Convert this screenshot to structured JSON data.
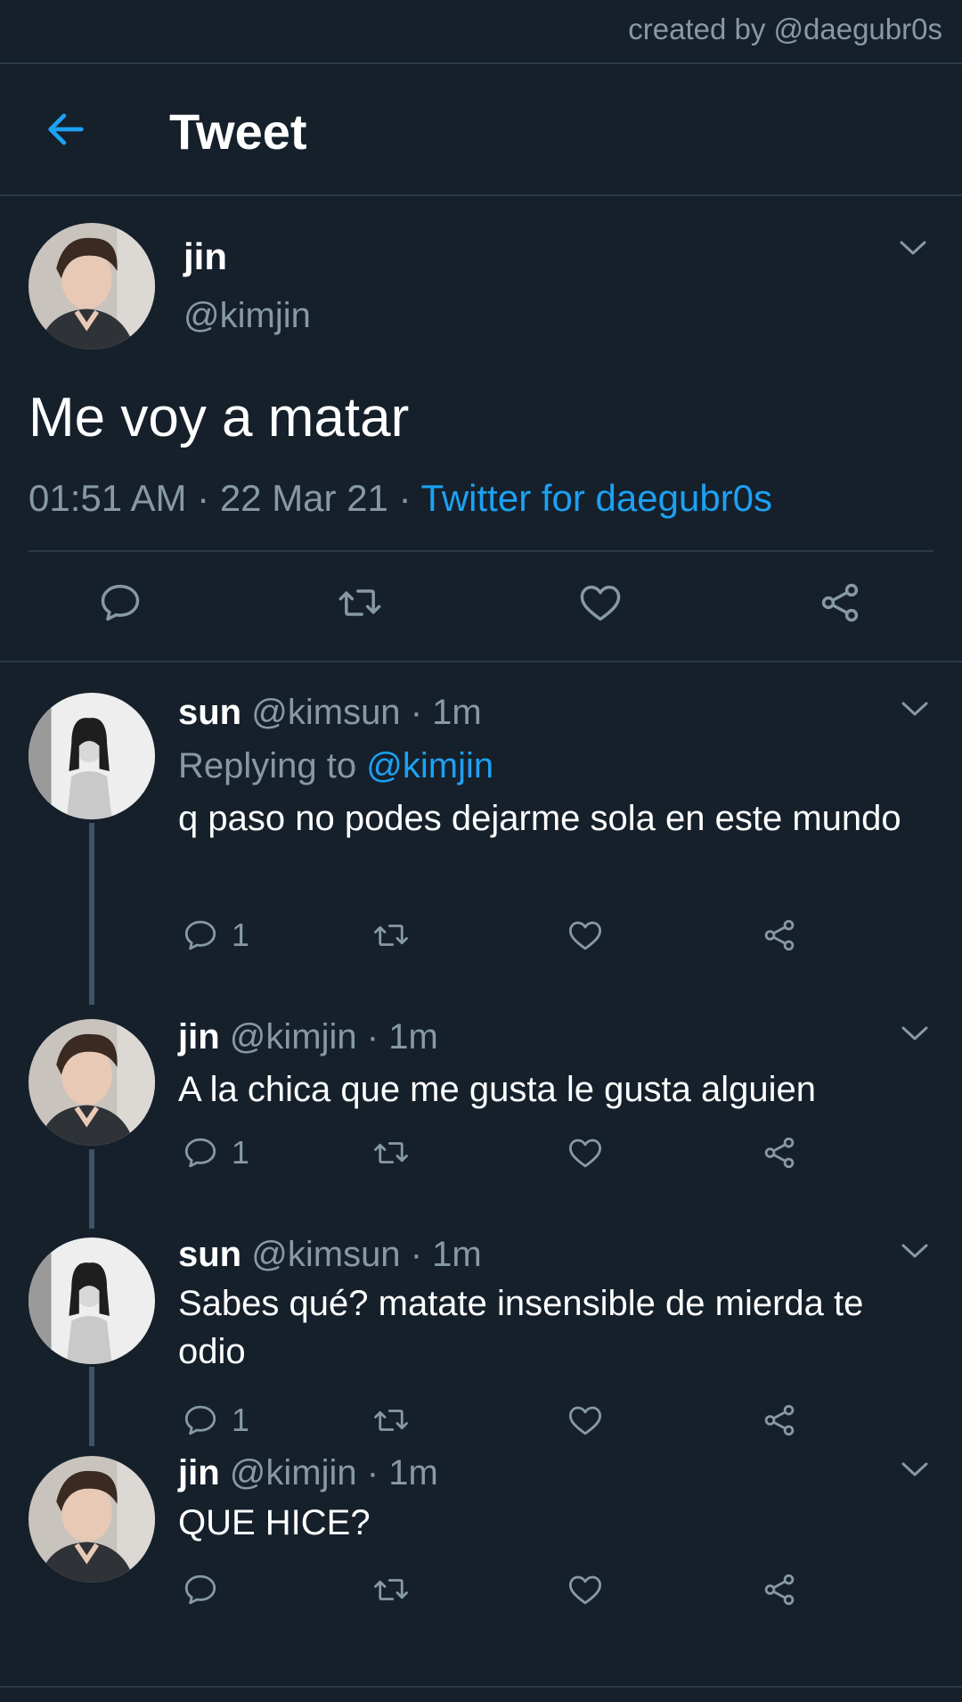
{
  "credit": "created by @daegubr0s",
  "header": {
    "title": "Tweet"
  },
  "main_tweet": {
    "name": "jin",
    "handle": "@kimjin",
    "text": "Me voy a matar",
    "time": "01:51 AM",
    "date": "22 Mar 21",
    "source": "Twitter for daegubr0s",
    "sep": "·"
  },
  "replies": [
    {
      "name": "sun",
      "handle": "@kimsun",
      "time": "· 1m",
      "replying_prefix": "Replying to",
      "replying_to": "@kimjin",
      "text": "q paso no podes dejarme sola en este mundo",
      "reply_count": "1"
    },
    {
      "name": "jin",
      "handle": "@kimjin",
      "time": "· 1m",
      "text": "A la chica que me gusta le gusta alguien",
      "reply_count": "1"
    },
    {
      "name": "sun",
      "handle": "@kimsun",
      "time": "· 1m",
      "text": "Sabes qué? matate insensible de mierda te odio",
      "reply_count": "1"
    },
    {
      "name": "jin",
      "handle": "@kimjin",
      "time": "· 1m",
      "text": "QUE HICE?",
      "reply_count": ""
    }
  ],
  "colors": {
    "background": "#15202b",
    "accent": "#1da1f2",
    "muted": "#8899a6",
    "divider": "#2b3a49"
  }
}
